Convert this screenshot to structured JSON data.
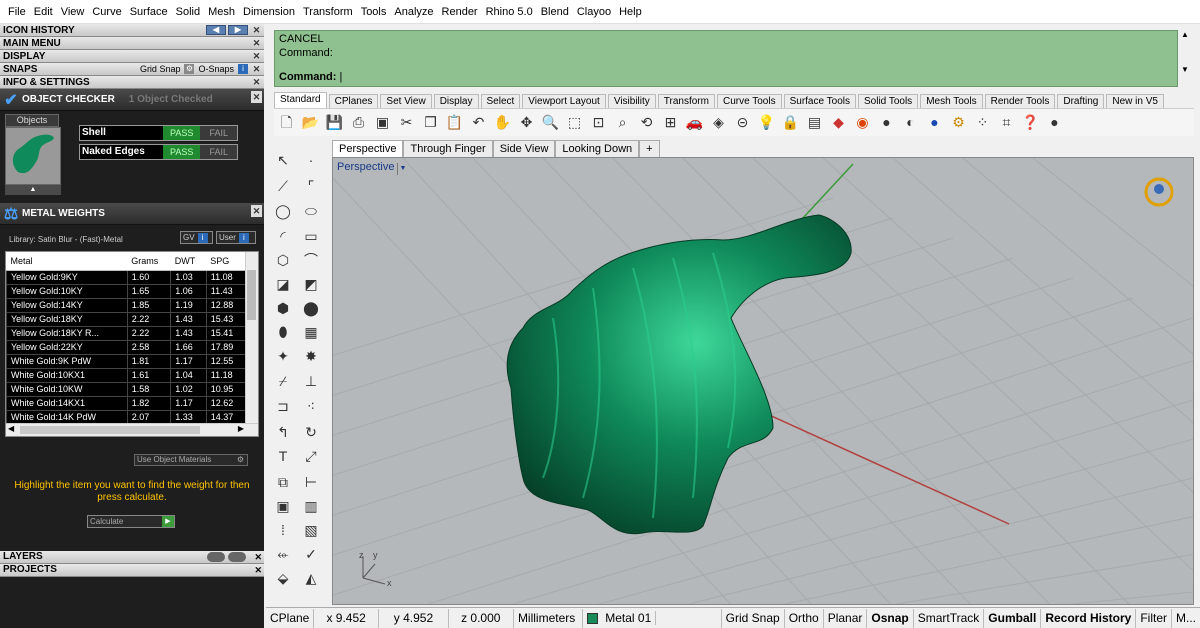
{
  "menu": [
    "File",
    "Edit",
    "View",
    "Curve",
    "Surface",
    "Solid",
    "Mesh",
    "Dimension",
    "Transform",
    "Tools",
    "Analyze",
    "Render",
    "Rhino 5.0",
    "Blend",
    "Clayoo",
    "Help"
  ],
  "panel": {
    "icon_history": "ICON HISTORY",
    "main_menu": "MAIN MENU",
    "display": "DISPLAY",
    "snaps": "SNAPS",
    "grid_snap": "Grid Snap",
    "o_snaps": "O-Snaps",
    "info_settings": "INFO & SETTINGS",
    "object_checker": "OBJECT CHECKER",
    "objects_checked": "1 Object Checked",
    "objects_tab": "Objects",
    "shell_label": "Shell",
    "naked_edges_label": "Naked Edges",
    "pass": "PASS",
    "fail": "FAIL",
    "metal_weights": "METAL WEIGHTS",
    "library": "Library: Satin Blur - (Fast)-Metal",
    "gv_btn": "GV",
    "user_btn": "User",
    "use_object_materials": "Use Object Materials",
    "hint": "Highlight the item you want to find the weight for then press calculate.",
    "calculate": "Calculate",
    "layers": "LAYERS",
    "projects": "PROJECTS"
  },
  "metal_table": {
    "headers": [
      "Metal",
      "Grams",
      "DWT",
      "SPG"
    ],
    "rows": [
      [
        "Yellow Gold:9KY",
        "1.60",
        "1.03",
        "11.08"
      ],
      [
        "Yellow Gold:10KY",
        "1.65",
        "1.06",
        "11.43"
      ],
      [
        "Yellow Gold:14KY",
        "1.85",
        "1.19",
        "12.88"
      ],
      [
        "Yellow Gold:18KY",
        "2.22",
        "1.43",
        "15.43"
      ],
      [
        "Yellow Gold:18KY R...",
        "2.22",
        "1.43",
        "15.41"
      ],
      [
        "Yellow Gold:22KY",
        "2.58",
        "1.66",
        "17.89"
      ],
      [
        "White Gold:9K PdW",
        "1.81",
        "1.17",
        "12.55"
      ],
      [
        "White Gold:10KX1",
        "1.61",
        "1.04",
        "11.18"
      ],
      [
        "White Gold:10KW",
        "1.58",
        "1.02",
        "10.95"
      ],
      [
        "White Gold:14KX1",
        "1.82",
        "1.17",
        "12.62"
      ],
      [
        "White Gold:14K PdW",
        "2.07",
        "1.33",
        "14.37"
      ]
    ]
  },
  "command": {
    "line1": "CANCEL",
    "line2": "Command:",
    "prompt": "Command:"
  },
  "toolbar_tabs": [
    "Standard",
    "CPlanes",
    "Set View",
    "Display",
    "Select",
    "Viewport Layout",
    "Visibility",
    "Transform",
    "Curve Tools",
    "Surface Tools",
    "Solid Tools",
    "Mesh Tools",
    "Render Tools",
    "Drafting",
    "New in V5"
  ],
  "viewport_tabs": [
    "Perspective",
    "Through Finger",
    "Side View",
    "Looking Down",
    "+"
  ],
  "viewport": {
    "label": "Perspective",
    "axis_z": "z",
    "axis_y": "y",
    "axis_x": "x"
  },
  "status": {
    "cplane": "CPlane",
    "x": "x 9.452",
    "y": "y 4.952",
    "z": "z 0.000",
    "units": "Millimeters",
    "layer": "Metal 01",
    "grid_snap": "Grid Snap",
    "ortho": "Ortho",
    "planar": "Planar",
    "osnap": "Osnap",
    "smarttrack": "SmartTrack",
    "gumball": "Gumball",
    "record_history": "Record History",
    "filter": "Filter",
    "more": "M..."
  },
  "colors": {
    "object_green": "#0f8a5a",
    "command_bg": "#8fc08f",
    "pass_green": "#1f8a2e",
    "hint_yellow": "#ffc400"
  }
}
